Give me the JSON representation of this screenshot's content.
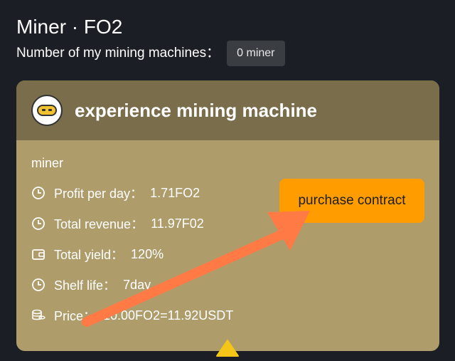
{
  "header": {
    "title": "Miner · FO2",
    "count_label": "Number of my mining machines：",
    "count_value": "0 miner"
  },
  "card": {
    "title": "experience mining machine",
    "type_label": "miner",
    "rows": [
      {
        "icon": "clock-icon",
        "label": "Profit per day：",
        "value": "1.71FO2"
      },
      {
        "icon": "clock-icon",
        "label": "Total revenue：",
        "value": "11.97F02"
      },
      {
        "icon": "wallet-icon",
        "label": "Total yield：",
        "value": "120%"
      },
      {
        "icon": "clock-icon",
        "label": "Shelf life：",
        "value": "7day"
      },
      {
        "icon": "coins-icon",
        "label": "Price：",
        "value": "10.00FO2=11.92USDT"
      }
    ],
    "purchase_label": "purchase contract"
  },
  "colors": {
    "background": "#1b1e24",
    "card_header": "#7a6d4b",
    "card_body": "#ae9c6b",
    "button": "#ff9d00",
    "arrow": "#ff7a45",
    "indicator": "#f5c518"
  }
}
